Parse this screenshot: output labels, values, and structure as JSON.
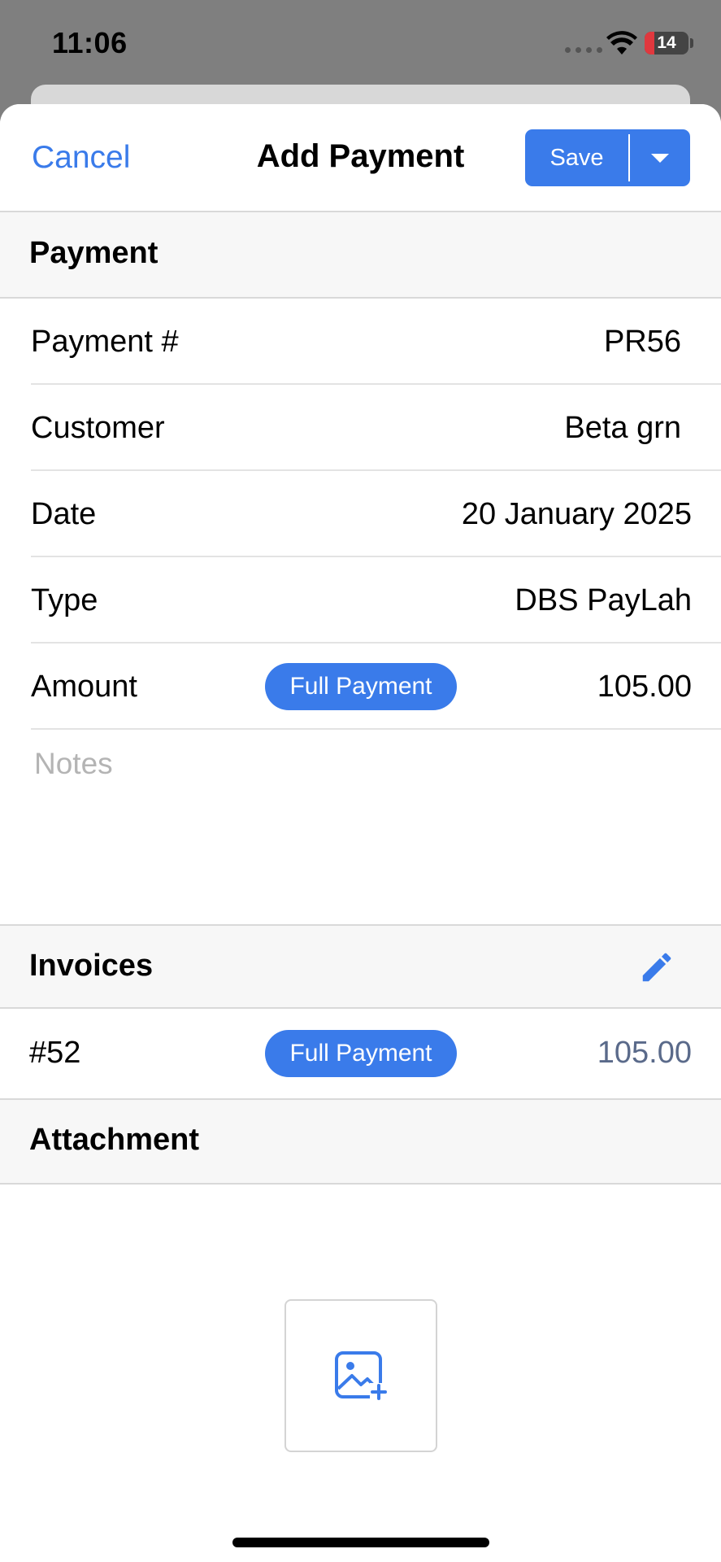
{
  "status": {
    "time": "11:06",
    "battery": "14"
  },
  "nav": {
    "cancel": "Cancel",
    "title": "Add Payment",
    "save": "Save"
  },
  "payment_section": {
    "title": "Payment",
    "rows": [
      {
        "label": "Payment #",
        "value": "PR56"
      },
      {
        "label": "Customer",
        "value": "Beta grn"
      },
      {
        "label": "Date",
        "value": "20 January 2025"
      },
      {
        "label": "Type",
        "value": "DBS PayLah"
      },
      {
        "label": "Amount",
        "badge": "Full Payment",
        "value": "105.00"
      }
    ],
    "notes_placeholder": "Notes"
  },
  "invoices_section": {
    "title": "Invoices",
    "items": [
      {
        "number": "#52",
        "badge": "Full Payment",
        "amount": "105.00"
      }
    ]
  },
  "attachment_section": {
    "title": "Attachment"
  },
  "colors": {
    "accent": "#3a7bea",
    "invoice_amount": "#5a6a8a"
  }
}
